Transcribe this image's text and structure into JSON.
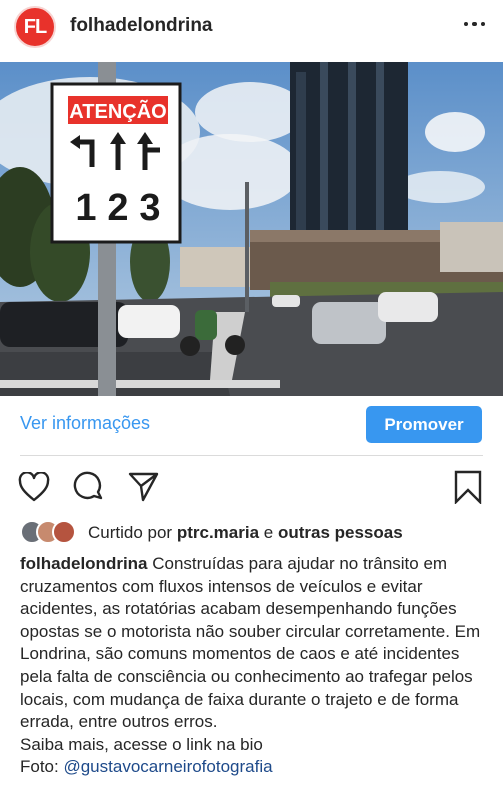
{
  "header": {
    "avatar_text": "FL",
    "account_name": "folhadelondrina",
    "more_icon": "more-horizontal-icon"
  },
  "photo": {
    "sign_heading": "ATENÇÃO",
    "lane_numbers": [
      "1",
      "2",
      "3"
    ]
  },
  "info_bar": {
    "ver_informacoes": "Ver informações",
    "promover": "Promover"
  },
  "actions": {
    "icons": [
      "heart-icon",
      "comment-icon",
      "share-icon",
      "bookmark-icon"
    ]
  },
  "likes": {
    "prefix": "Curtido por ",
    "user": "ptrc.maria",
    "middle": " e ",
    "others": "outras pessoas"
  },
  "caption": {
    "user": "folhadelondrina",
    "text": "Construídas para ajudar no trânsito em cruzamentos com fluxos intensos de veículos e evitar acidentes, as rotatórias acabam desempenhando funções opostas se o motorista não souber circular corretamente. Em Londrina, são comuns momentos de caos e até incidentes pela falta de consciência ou conhecimento ao trafegar pelos locais, com mudança de faixa durante o trajeto e de forma errada, entre outros erros.",
    "line2": "Saiba mais, acesse o link na bio",
    "foto_label": "Foto: ",
    "foto_handle": "@gustavocarneirofotografia"
  },
  "colors": {
    "brand_red": "#e8322b",
    "link_blue": "#3897f0",
    "handle_blue": "#1e4a8a"
  }
}
